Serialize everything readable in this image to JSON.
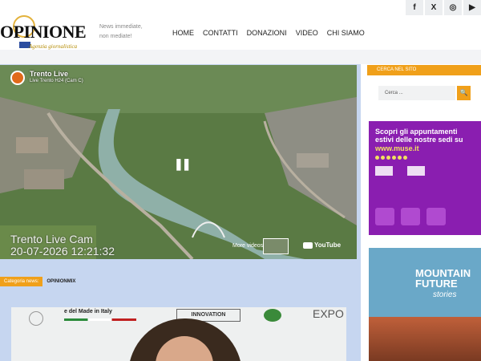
{
  "social": [
    "f",
    "X",
    "◎",
    "▶"
  ],
  "logo": {
    "title": "OPINIONE",
    "subtitle": "Agenzia giornalistica"
  },
  "tagline": [
    "News immediate,",
    "non mediate!"
  ],
  "nav": [
    "HOME",
    "CONTATTI",
    "DONAZIONI",
    "VIDEO",
    "CHI SIAMO"
  ],
  "video": {
    "channel": "Trento Live",
    "subtitle": "Live Trento H24 (Cam C)",
    "overlay_line1": "Trento Live Cam",
    "overlay_line2": "20-07-2026 12:21:32",
    "more_videos": "More videos",
    "youtube": "YouTube",
    "pause": "❚❚"
  },
  "category": {
    "badge": "Categoria news:",
    "name": "OPINIONMIX"
  },
  "article_image_text": {
    "banner": "e del Made in Italy",
    "innovation": "INNOVATION",
    "expo": "EXPO"
  },
  "sidebar": {
    "search_heading": "CERCA NEL SITO",
    "search_placeholder": "Cerca ...",
    "search_button": "🔍",
    "ad1_title": "Scopri gli appuntamenti estivi delle nostre sedi su",
    "ad1_site": "www.muse.it",
    "ad2_title": "MOUNTAIN FUTURE",
    "ad2_sub": "stories"
  }
}
